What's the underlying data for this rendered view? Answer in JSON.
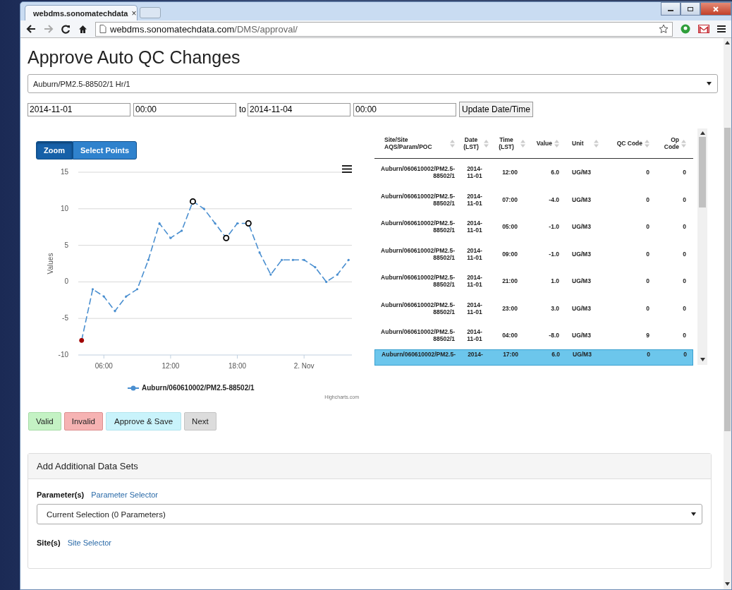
{
  "browser": {
    "tab_title": "webdms.sonomatechdata",
    "tab_close": "×",
    "url_host": "webdms.sonomatechdata.com",
    "url_path": "/DMS/approval/"
  },
  "page": {
    "title": "Approve Auto QC Changes",
    "series_select": "Auburn/PM2.5-88502/1 Hr/1",
    "date_range": {
      "start_date": "2014-11-01",
      "start_time": "00:00",
      "to_label": "to",
      "end_date": "2014-11-04",
      "end_time": "00:00",
      "update_button": "Update Date/Time"
    },
    "chart": {
      "modes": [
        {
          "label": "Zoom",
          "selected": true
        },
        {
          "label": "Select Points",
          "selected": false
        }
      ],
      "credit": "Highcharts.com",
      "point_marks": [
        {
          "selected": false,
          "flagged": true
        },
        {
          "selected": false,
          "flagged": false
        },
        {
          "selected": false,
          "flagged": false
        },
        {
          "selected": false,
          "flagged": false
        },
        {
          "selected": false,
          "flagged": false
        },
        {
          "selected": false,
          "flagged": false
        },
        {
          "selected": false,
          "flagged": false
        },
        {
          "selected": false,
          "flagged": false
        },
        {
          "selected": false,
          "flagged": false
        },
        {
          "selected": false,
          "flagged": false
        },
        {
          "selected": true,
          "flagged": false
        },
        {
          "selected": false,
          "flagged": false
        },
        {
          "selected": false,
          "flagged": false
        },
        {
          "selected": true,
          "flagged": false
        },
        {
          "selected": false,
          "flagged": false
        },
        {
          "selected": true,
          "flagged": false
        },
        {
          "selected": false,
          "flagged": false
        },
        {
          "selected": false,
          "flagged": false
        },
        {
          "selected": false,
          "flagged": false
        },
        {
          "selected": false,
          "flagged": false
        },
        {
          "selected": false,
          "flagged": false
        },
        {
          "selected": false,
          "flagged": false
        },
        {
          "selected": false,
          "flagged": false
        },
        {
          "selected": false,
          "flagged": false
        },
        {
          "selected": false,
          "flagged": false
        }
      ],
      "chart_data": {
        "type": "line",
        "ylabel": "Values",
        "x": [
          4,
          5,
          6,
          7,
          8,
          9,
          10,
          11,
          12,
          13,
          14,
          15,
          16,
          17,
          18,
          19,
          20,
          21,
          22,
          23,
          24,
          25,
          26,
          27,
          28
        ],
        "grid": true,
        "series": [
          {
            "name": "Auburn/060610002/PM2.5-88502/1",
            "color": "#4a8fd0",
            "line_style": "dashed",
            "values": [
              -8,
              -1,
              -2,
              -4,
              -2,
              -1,
              3,
              8,
              6,
              7,
              11,
              10,
              8,
              6,
              8,
              8,
              4,
              1,
              3,
              3,
              3,
              2,
              0,
              1,
              3
            ]
          }
        ],
        "xlim": [
          3.7,
          28.3
        ],
        "ylim": [
          -10,
          15
        ],
        "xticks": [
          {
            "value": 6,
            "label": "06:00"
          },
          {
            "value": 12,
            "label": "12:00"
          },
          {
            "value": 18,
            "label": "18:00"
          },
          {
            "value": 24,
            "label": "2. Nov"
          }
        ],
        "yticks": [
          -10,
          -5,
          0,
          5,
          10,
          15
        ]
      }
    },
    "table": {
      "columns": [
        "Site/Site AQS/Param/POC",
        "Date (LST)",
        "Time (LST)",
        "Value",
        "Unit",
        "QC Code",
        "Op Code"
      ],
      "rows": [
        {
          "cells": [
            "Auburn/060610002/PM2.5-88502/1",
            "2014-11-01",
            "12:00",
            "6.0",
            "UG/M3",
            "0",
            "0"
          ],
          "selected": false
        },
        {
          "cells": [
            "Auburn/060610002/PM2.5-88502/1",
            "2014-11-01",
            "07:00",
            "-4.0",
            "UG/M3",
            "0",
            "0"
          ],
          "selected": false
        },
        {
          "cells": [
            "Auburn/060610002/PM2.5-88502/1",
            "2014-11-01",
            "05:00",
            "-1.0",
            "UG/M3",
            "0",
            "0"
          ],
          "selected": false
        },
        {
          "cells": [
            "Auburn/060610002/PM2.5-88502/1",
            "2014-11-01",
            "09:00",
            "-1.0",
            "UG/M3",
            "0",
            "0"
          ],
          "selected": false
        },
        {
          "cells": [
            "Auburn/060610002/PM2.5-88502/1",
            "2014-11-01",
            "21:00",
            "1.0",
            "UG/M3",
            "0",
            "0"
          ],
          "selected": false
        },
        {
          "cells": [
            "Auburn/060610002/PM2.5-88502/1",
            "2014-11-01",
            "23:00",
            "3.0",
            "UG/M3",
            "0",
            "0"
          ],
          "selected": false
        },
        {
          "cells": [
            "Auburn/060610002/PM2.5-88502/1",
            "2014-11-01",
            "04:00",
            "-8.0",
            "UG/M3",
            "9",
            "0"
          ],
          "selected": false
        },
        {
          "cells": [
            "Auburn/060610002/PM2.5-",
            "2014-",
            "17:00",
            "6.0",
            "UG/M3",
            "0",
            "0"
          ],
          "selected": true
        }
      ]
    },
    "actions": [
      {
        "label": "Valid",
        "kind": "valid"
      },
      {
        "label": "Invalid",
        "kind": "invalid"
      },
      {
        "label": "Approve & Save",
        "kind": "approve"
      },
      {
        "label": "Next",
        "kind": "next"
      }
    ],
    "panel": {
      "title": "Add Additional Data Sets",
      "fields": [
        {
          "label": "Parameter(s)",
          "link": "Parameter Selector",
          "select": "Current Selection (0 Parameters)"
        },
        {
          "label": "Site(s)",
          "link": "Site Selector"
        }
      ]
    }
  }
}
